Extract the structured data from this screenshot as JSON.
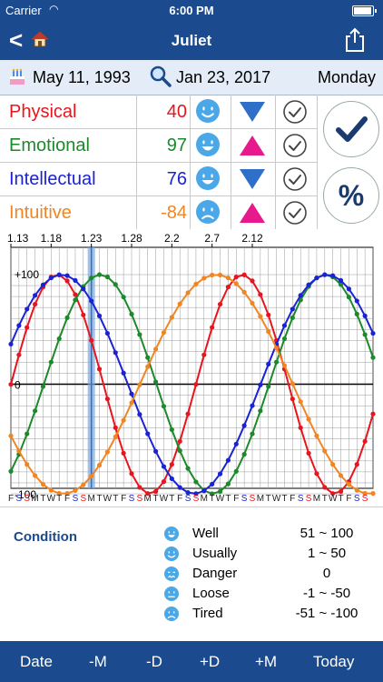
{
  "status": {
    "carrier": "Carrier",
    "time": "6:00 PM"
  },
  "nav": {
    "title": "Juliet",
    "back_glyph": "<",
    "home_icon": "home-icon",
    "share_icon": "share-icon"
  },
  "dates": {
    "birth": "May 11, 1993",
    "current": "Jan 23, 2017",
    "weekday": "Monday"
  },
  "colors": {
    "bar": "#1b4b8e",
    "physical": "#e8141e",
    "emotional": "#1a8a2a",
    "intellectual": "#1a22d4",
    "intuitive": "#f08522",
    "face": "#4aa8e8",
    "down": "#2f6fc9",
    "up": "#e8198c"
  },
  "rows": [
    {
      "label": "Physical",
      "value": "40",
      "trend": "down",
      "face": "smile"
    },
    {
      "label": "Emotional",
      "value": "97",
      "trend": "up",
      "face": "grin"
    },
    {
      "label": "Intellectual",
      "value": "76",
      "trend": "down",
      "face": "grin"
    },
    {
      "label": "Intuitive",
      "value": "-84",
      "trend": "up",
      "face": "sad"
    }
  ],
  "side_buttons": [
    {
      "name": "check-all-button",
      "glyph": "check"
    },
    {
      "name": "percent-button",
      "glyph": "%"
    }
  ],
  "chart_data": {
    "type": "line",
    "top_labels": [
      "1.13",
      "1.18",
      "1.23",
      "1.28",
      "2.2",
      "2.7",
      "2.12"
    ],
    "y_labels": [
      "+100",
      "0",
      "-100"
    ],
    "day_letters": [
      "F",
      "S",
      "S",
      "M",
      "T",
      "W",
      "T",
      "F",
      "S",
      "S",
      "M",
      "T",
      "W",
      "T",
      "F",
      "S",
      "S",
      "M",
      "T",
      "W",
      "T",
      "F",
      "S",
      "S",
      "M",
      "T",
      "W",
      "T",
      "F",
      "S",
      "S",
      "M",
      "T",
      "W",
      "T",
      "F",
      "S",
      "S",
      "M",
      "T",
      "W",
      "T",
      "F",
      "S",
      "S"
    ],
    "x_days": 45,
    "today_index": 10,
    "ylim": [
      -100,
      100
    ],
    "series": [
      {
        "key": "physical",
        "period": 23,
        "today": 40,
        "trend": "down"
      },
      {
        "key": "emotional",
        "period": 28,
        "today": 97,
        "trend": "up"
      },
      {
        "key": "intellectual",
        "period": 33,
        "today": 76,
        "trend": "down"
      },
      {
        "key": "intuitive",
        "period": 38,
        "today": -84,
        "trend": "up"
      }
    ]
  },
  "legend": {
    "title": "Condition",
    "items": [
      {
        "name": "Well",
        "range": "51 ~ 100",
        "face": "grin"
      },
      {
        "name": "Usually",
        "range": "1 ~ 50",
        "face": "smile"
      },
      {
        "name": "Danger",
        "range": "0",
        "face": "danger"
      },
      {
        "name": "Loose",
        "range": "-1 ~ -50",
        "face": "neutral"
      },
      {
        "name": "Tired",
        "range": "-51 ~ -100",
        "face": "sad"
      }
    ]
  },
  "toolbar": {
    "date": "Date",
    "minus_m": "-M",
    "minus_d": "-D",
    "plus_d": "+D",
    "plus_m": "+M",
    "today": "Today"
  }
}
